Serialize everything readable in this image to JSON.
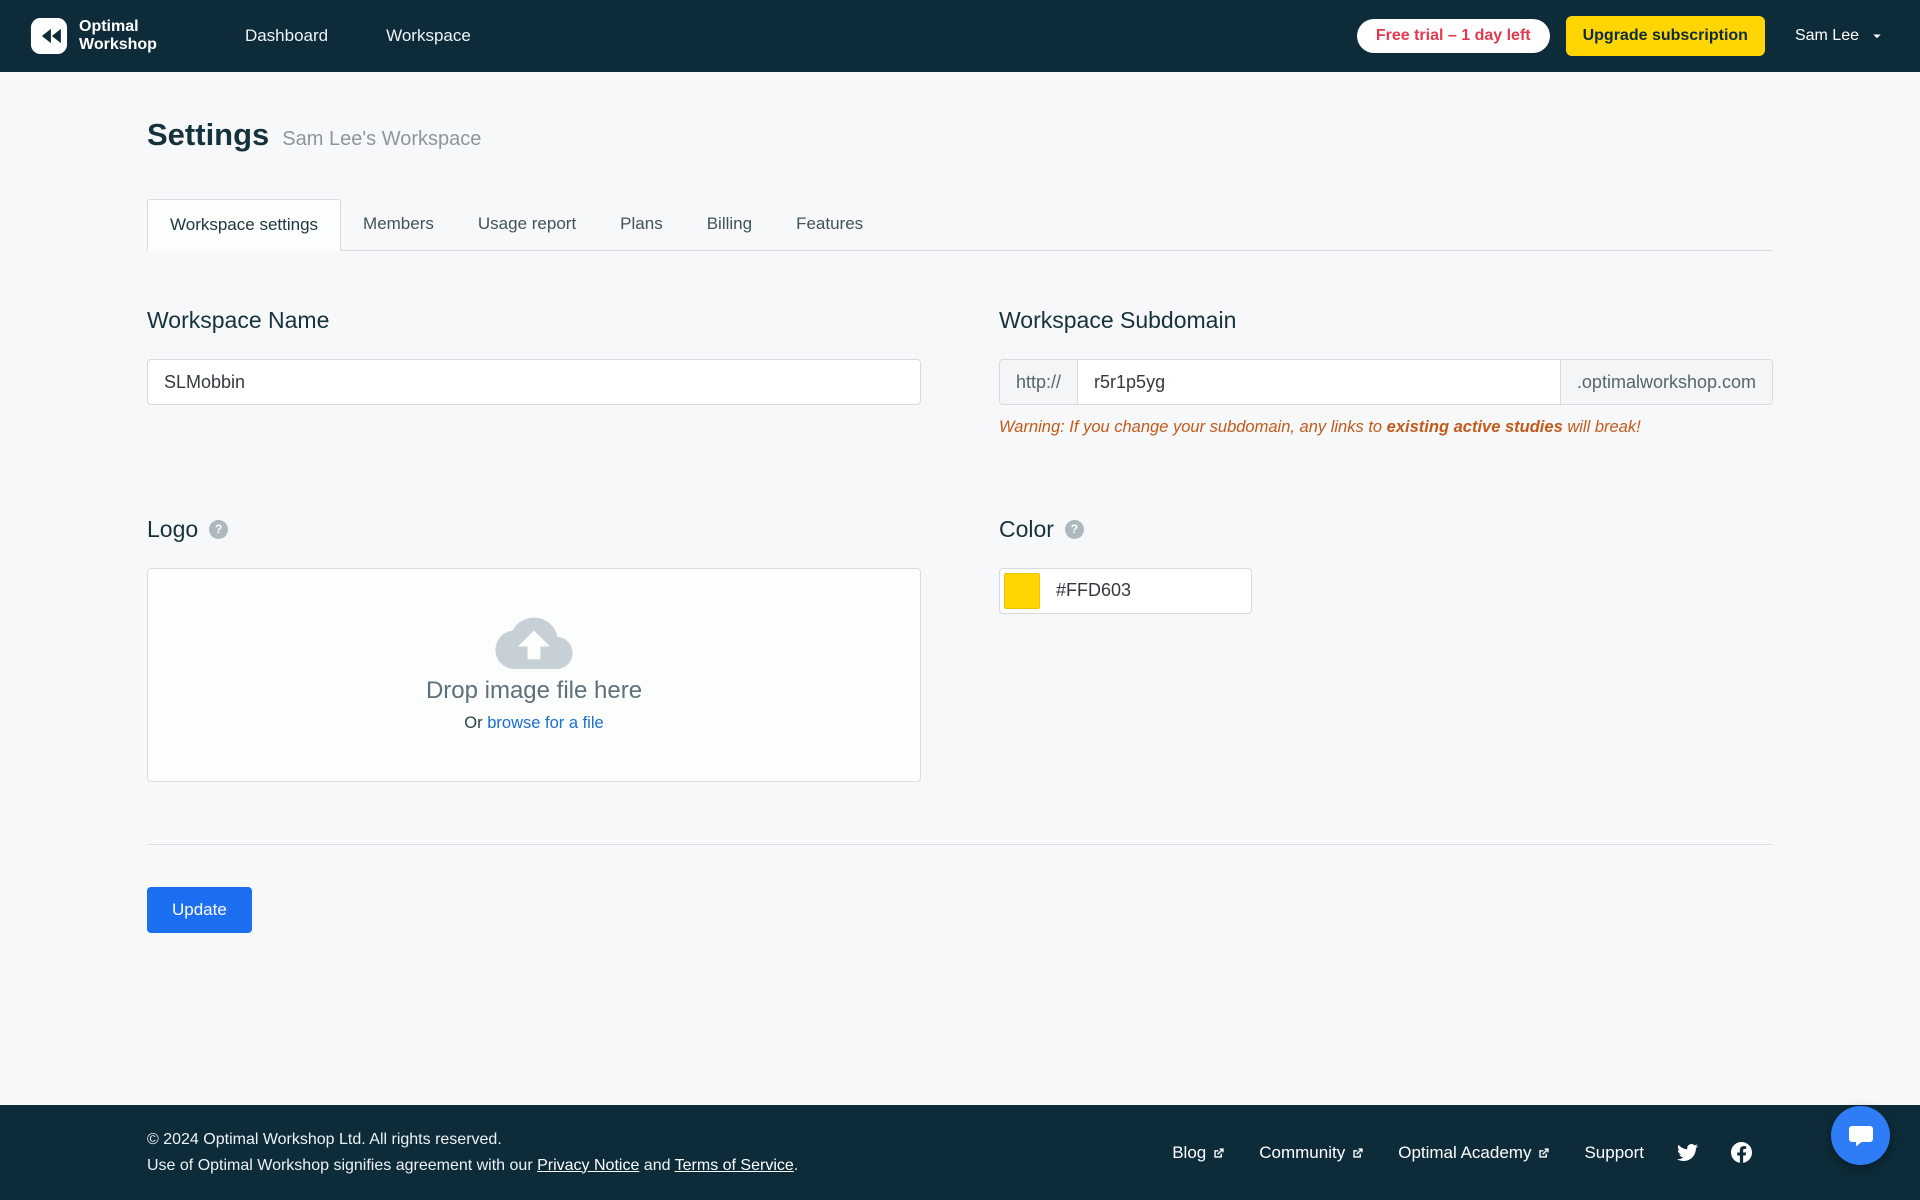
{
  "navbar": {
    "brand": {
      "line1": "Optimal",
      "line2": "Workshop"
    },
    "links": [
      {
        "label": "Dashboard"
      },
      {
        "label": "Workspace"
      }
    ],
    "trial_badge": "Free trial – 1 day left",
    "upgrade_button": "Upgrade subscription",
    "user_name": "Sam Lee"
  },
  "page": {
    "title": "Settings",
    "subtitle": "Sam Lee's Workspace"
  },
  "tabs": [
    {
      "label": "Workspace settings",
      "active": true
    },
    {
      "label": "Members",
      "active": false
    },
    {
      "label": "Usage report",
      "active": false
    },
    {
      "label": "Plans",
      "active": false
    },
    {
      "label": "Billing",
      "active": false
    },
    {
      "label": "Features",
      "active": false
    }
  ],
  "form": {
    "workspace_name": {
      "label": "Workspace Name",
      "value": "SLMobbin"
    },
    "subdomain": {
      "label": "Workspace Subdomain",
      "prefix": "http://",
      "value": "r5r1p5yg",
      "suffix": ".optimalworkshop.com",
      "warning_prefix": "Warning: If you change your subdomain, any links to ",
      "warning_bold": "existing active studies",
      "warning_suffix": " will break!"
    },
    "logo": {
      "label": "Logo",
      "drop_text": "Drop image file here",
      "or_text": "Or ",
      "browse_link": "browse for a file"
    },
    "color": {
      "label": "Color",
      "value": "#FFD603",
      "swatch": "#FFD603"
    },
    "update_button": "Update"
  },
  "footer": {
    "copyright": "© 2024 Optimal Workshop Ltd. All rights reserved.",
    "agreement_prefix": "Use of Optimal Workshop signifies agreement with our ",
    "privacy_link": "Privacy Notice",
    "and_text": " and ",
    "terms_link": "Terms of Service",
    "period": ".",
    "links": [
      {
        "label": "Blog",
        "external": true
      },
      {
        "label": "Community",
        "external": true
      },
      {
        "label": "Optimal Academy",
        "external": true
      },
      {
        "label": "Support",
        "external": false
      }
    ]
  },
  "icons": {
    "help_glyph": "?"
  },
  "colors": {
    "navbar_bg": "#0d2b38",
    "accent_yellow": "#FFD603",
    "primary_blue": "#1d6ff2",
    "link_blue": "#1a6ed0",
    "warning_orange": "#c25a1a",
    "trial_red": "#e03a4e",
    "chat_blue": "#2e7cf6"
  }
}
